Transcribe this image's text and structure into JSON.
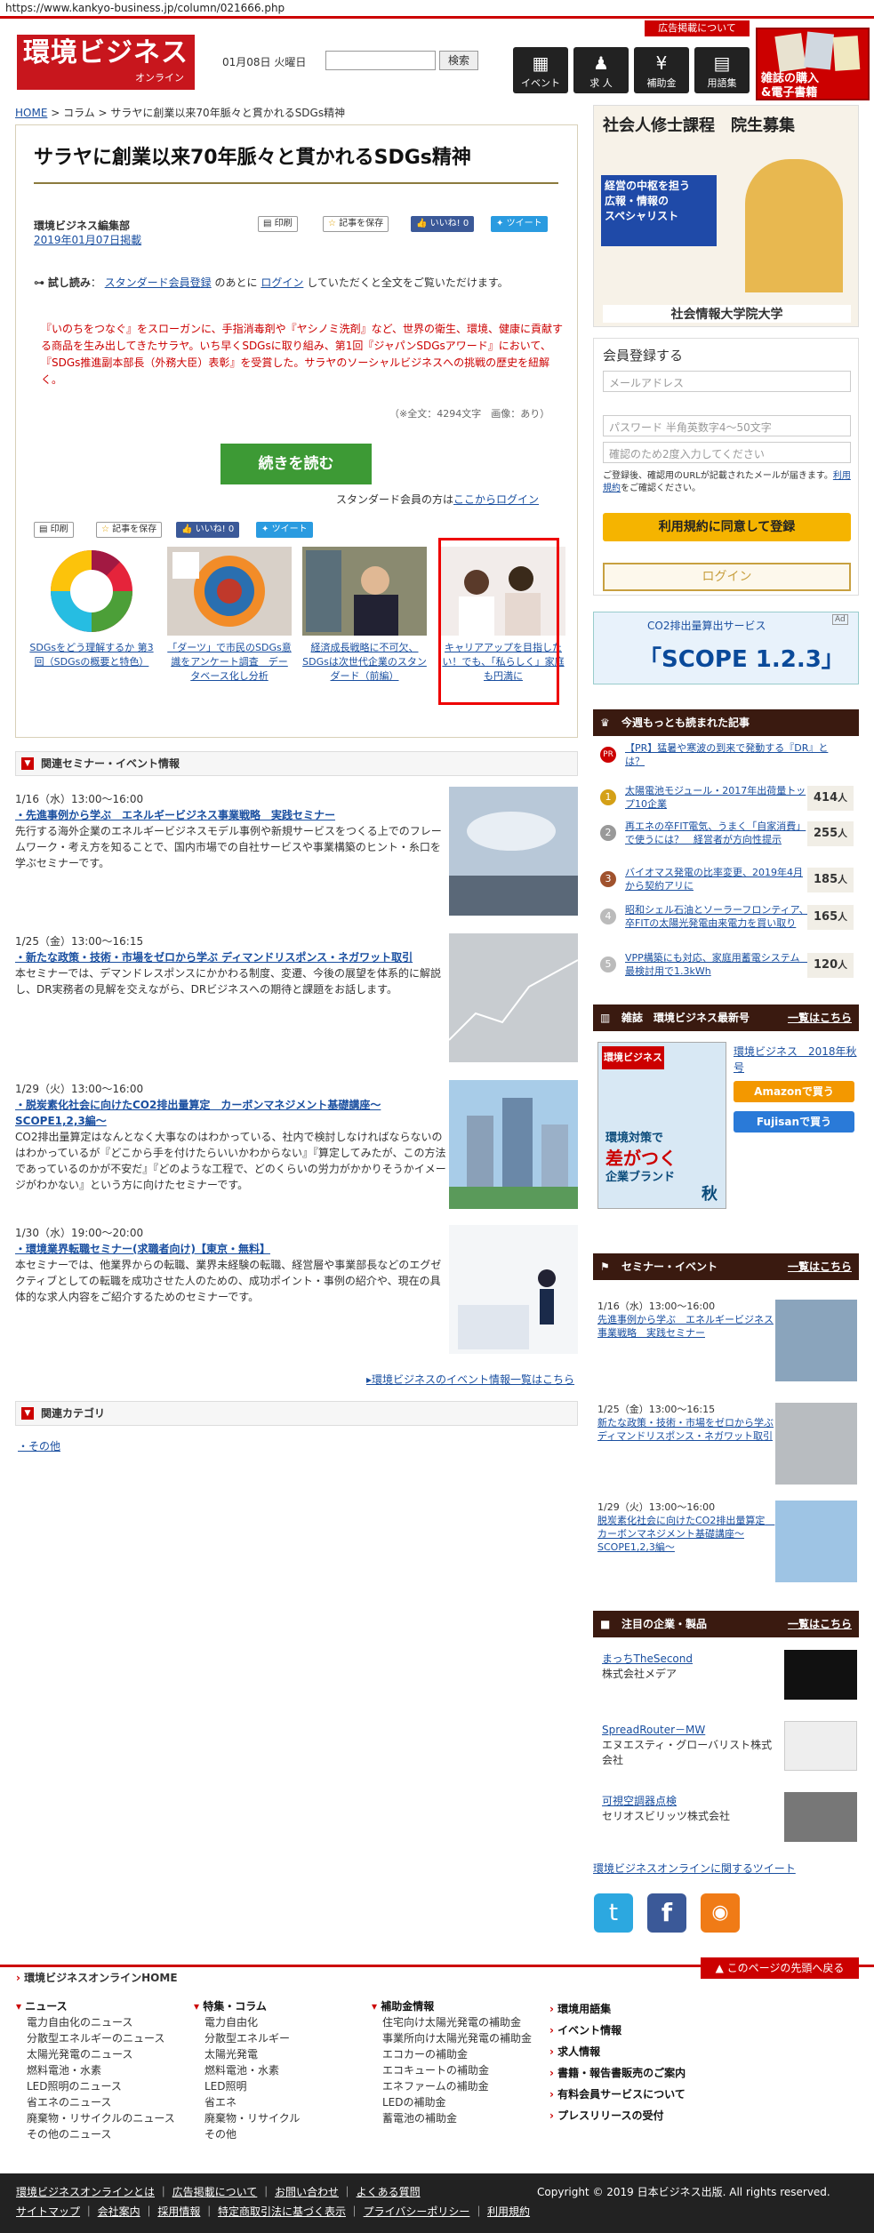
{
  "url": "https://www.kankyo-business.jp/column/021666.php",
  "header": {
    "logo_main": "環境ビジネス",
    "logo_sub": "オンライン",
    "date": "01月08日 火曜日",
    "search_placeholder": "",
    "search_button": "検索",
    "ad_button": "広告掲載について",
    "nav": [
      {
        "label": "イベント",
        "icon": "calendar-icon",
        "glyph": "▦"
      },
      {
        "label": "求 人",
        "icon": "person-icon",
        "glyph": "♟"
      },
      {
        "label": "補助金",
        "icon": "yen-icon",
        "glyph": "¥"
      },
      {
        "label": "用語集",
        "icon": "book-icon",
        "glyph": "▤"
      }
    ],
    "shop_banner": "雑誌の購入\n&電子書籍"
  },
  "breadcrumb": [
    "HOME",
    "コラム",
    "サラヤに創業以来70年脈々と貫かれるSDGs精神"
  ],
  "article": {
    "title": "サラヤに創業以来70年脈々と貫かれるSDGs精神",
    "author": "環境ビジネス編集部",
    "date": "2019年01月07日掲載",
    "print": "印刷",
    "save": "記事を保存",
    "like": "いいね! 0",
    "tweet": "ツイート",
    "trial_label": "試し読み",
    "trial_link1": "スタンダード会員登録",
    "trial_mid": "のあとに",
    "trial_link2": "ログイン",
    "trial_end": "していただくと全文をご覧いただけます。",
    "lead": "『いのちをつなぐ』をスローガンに、手指消毒剤や『ヤシノミ洗剤』など、世界の衛生、環境、健康に貢献する商品を生み出してきたサラヤ。いち早くSDGsに取り組み、第1回『ジャパンSDGsアワード』において、『SDGs推進副本部長（外務大臣）表彰』を受賞した。サラヤのソーシャルビジネスへの挑戦の歴史を紐解く。",
    "meta": "（※全文：4294文字　画像：あり）",
    "read_more": "続きを読む",
    "login_prefix": "スタンダード会員の方は",
    "login_link": "ここからログイン",
    "related": [
      {
        "caption": "SDGsをどう理解するか 第3回（SDGsの概要と特色）"
      },
      {
        "caption": "「ダーツ」で市民のSDGs意識をアンケート調査　データベース化し分析"
      },
      {
        "caption": "経済成長戦略に不可欠、SDGsは次世代企業のスタンダード（前編）"
      },
      {
        "caption": "キャリアアップを目指したい！でも、「私らしく」家庭も円満に"
      }
    ]
  },
  "seminars": {
    "heading": "関連セミナー・イベント情報",
    "items": [
      {
        "date": "1/16（水）13:00〜16:00",
        "title": "・先進事例から学ぶ　エネルギービジネス事業戦略　実践セミナー",
        "desc": "先行する海外企業のエネルギービジネスモデル事例や新規サービスをつくる上でのフレームワーク・考え方を知ることで、国内市場での自社サービスや事業構築のヒント・糸口を学ぶセミナーです。"
      },
      {
        "date": "1/25（金）13:00〜16:15",
        "title": "・新たな政策・技術・市場をゼロから学ぶ ディマンドリスポンス・ネガワット取引",
        "desc": "本セミナーでは、デマンドレスポンスにかかわる制度、変遷、今後の展望を体系的に解説し、DR実務者の見解を交えながら、DRビジネスへの期待と課題をお話します。"
      },
      {
        "date": "1/29（火）13:00〜16:00",
        "title": "・脱炭素化社会に向けたCO2排出量算定　カーボンマネジメント基礎講座〜SCOPE1,2,3編〜",
        "desc": "CO2排出量算定はなんとなく大事なのはわかっている、社内で検討しなければならないのはわかっているが『どこから手を付けたらいいかわからない』『算定してみたが、この方法であっているのかが不安だ』『どのような工程で、どのくらいの労力がかかりそうかイメージがわかない』という方に向けたセミナーです。"
      },
      {
        "date": "1/30（水）19:00〜20:00",
        "title": "・環境業界転職セミナー(求職者向け)【東京・無料】",
        "desc": "本セミナーでは、他業界からの転職、業界未経験の転職、経営層や事業部長などのエグゼクティブとしての転職を成功させた人のための、成功ポイント・事例の紹介や、現在の具体的な求人内容をご紹介するためのセミナーです。"
      }
    ],
    "more": "環境ビジネスのイベント情報一覧はこちら"
  },
  "categories": {
    "heading": "関連カテゴリ",
    "items": [
      "・その他"
    ]
  },
  "sidebar": {
    "ad1": {
      "title": "社会人修士課程　院生募集",
      "copy": "経営の中枢を担う\n広報・情報の\nスペシャリスト",
      "school": "社会情報大学院大学"
    },
    "register": {
      "heading": "会員登録する",
      "email_ph": "メールアドレス",
      "pw_ph": "パスワード 半角英数字4〜50文字",
      "pw2_ph": "確認のため2度入力してください",
      "note": "ご登録後、確認用のURLが記載されたメールが届きます。",
      "terms": "利用規約",
      "note2": "をご確認ください。",
      "submit": "利用規約に同意して登録",
      "login": "ログイン"
    },
    "ad2": {
      "title": "CO2排出量算出サービス",
      "big": "「SCOPE 1.2.3」",
      "badge": "Ad"
    },
    "ranking": {
      "heading": "今週もっとも読まれた記事",
      "pr": "【PR】猛暑や寒波の到来で発動する『DR』とは？",
      "items": [
        {
          "n": "1",
          "text": "太陽電池モジュール・2017年出荷量トップ10企業",
          "count": "414"
        },
        {
          "n": "2",
          "text": "再エネの卒FIT電気、うまく「自家消費」で使うには？　経営者が方向性提示",
          "count": "255"
        },
        {
          "n": "3",
          "text": "バイオマス発電の比率変更、2019年4月から契約アリに",
          "count": "185"
        },
        {
          "n": "4",
          "text": "昭和シェル石油とソーラーフロンティア、卒FITの太陽光発電由来電力を買い取り",
          "count": "165"
        },
        {
          "n": "5",
          "text": "VPP構築にも対応、家庭用蓄電システム　最検討用で1.3kWh",
          "count": "120"
        }
      ],
      "unit": "人"
    },
    "magazine": {
      "heading": "雑誌　環境ビジネス最新号",
      "more": "一覧はこちら",
      "issue": "環境ビジネス　2018年秋号",
      "cover_title": "環境ビジネス",
      "cover_line1": "環境対策で",
      "cover_line2": "差がつく",
      "cover_line3": "企業ブランド",
      "cover_season": "秋",
      "amazon": "Amazonで買う",
      "fujisan": "Fujisanで買う"
    },
    "seminars": {
      "heading": "セミナー・イベント",
      "more": "一覧はこちら",
      "items": [
        {
          "date": "1/16（水）13:00〜16:00",
          "title": "先進事例から学ぶ　エネルギービジネス事業戦略　実践セミナー"
        },
        {
          "date": "1/25（金）13:00〜16:15",
          "title": "新たな政策・技術・市場をゼロから学ぶ ディマンドリスポンス・ネガワット取引"
        },
        {
          "date": "1/29（火）13:00〜16:00",
          "title": "脱炭素化社会に向けたCO2排出量算定　カーボンマネジメント基礎講座〜SCOPE1,2,3編〜"
        }
      ]
    },
    "companies": {
      "heading": "注目の企業・製品",
      "more": "一覧はこちら",
      "items": [
        {
          "product": "まっちTheSecond",
          "company": "株式会社メデア"
        },
        {
          "product": "SpreadRouter－MW",
          "company": "エヌエスティ・グローバリスト株式会社"
        },
        {
          "product": "可視空調器点検",
          "company": "セリオスビリッツ株式会社"
        }
      ]
    },
    "tweet_link": "環境ビジネスオンラインに関するツイート",
    "social": [
      "twitter-icon",
      "facebook-icon",
      "rss-icon"
    ]
  },
  "footer": {
    "home": "環境ビジネスオンラインHOME",
    "pagetop": "このページの先頭へ戻る",
    "cols": [
      {
        "head": "ニュース",
        "items": [
          "電力自由化のニュース",
          "分散型エネルギーのニュース",
          "太陽光発電のニュース",
          "燃料電池・水素",
          "LED照明のニュース",
          "省エネのニュース",
          "廃棄物・リサイクルのニュース",
          "その他のニュース"
        ]
      },
      {
        "head": "特集・コラム",
        "items": [
          "電力自由化",
          "分散型エネルギー",
          "太陽光発電",
          "燃料電池・水素",
          "LED照明",
          "省エネ",
          "廃棄物・リサイクル",
          "その他"
        ]
      },
      {
        "head": "補助金情報",
        "items": [
          "住宅向け太陽光発電の補助金",
          "事業所向け太陽光発電の補助金",
          "エコカーの補助金",
          "エコキュートの補助金",
          "エネファームの補助金",
          "LEDの補助金",
          "蓄電池の補助金"
        ]
      },
      {
        "head": "",
        "items": []
      }
    ],
    "right_links": [
      "環境用語集",
      "イベント情報",
      "求人情報",
      "書籍・報告書販売のご案内",
      "有料会員サービスについて",
      "プレスリリースの受付"
    ],
    "bottom_row1": [
      "環境ビジネスオンラインとは",
      "広告掲載について",
      "お問い合わせ",
      "よくある質問"
    ],
    "bottom_row2": [
      "サイトマップ",
      "会社案内",
      "採用情報",
      "特定商取引法に基づく表示",
      "プライバシーポリシー",
      "利用規約"
    ],
    "copyright": "Copyright © 2019 日本ビジネス出版. All rights reserved."
  }
}
